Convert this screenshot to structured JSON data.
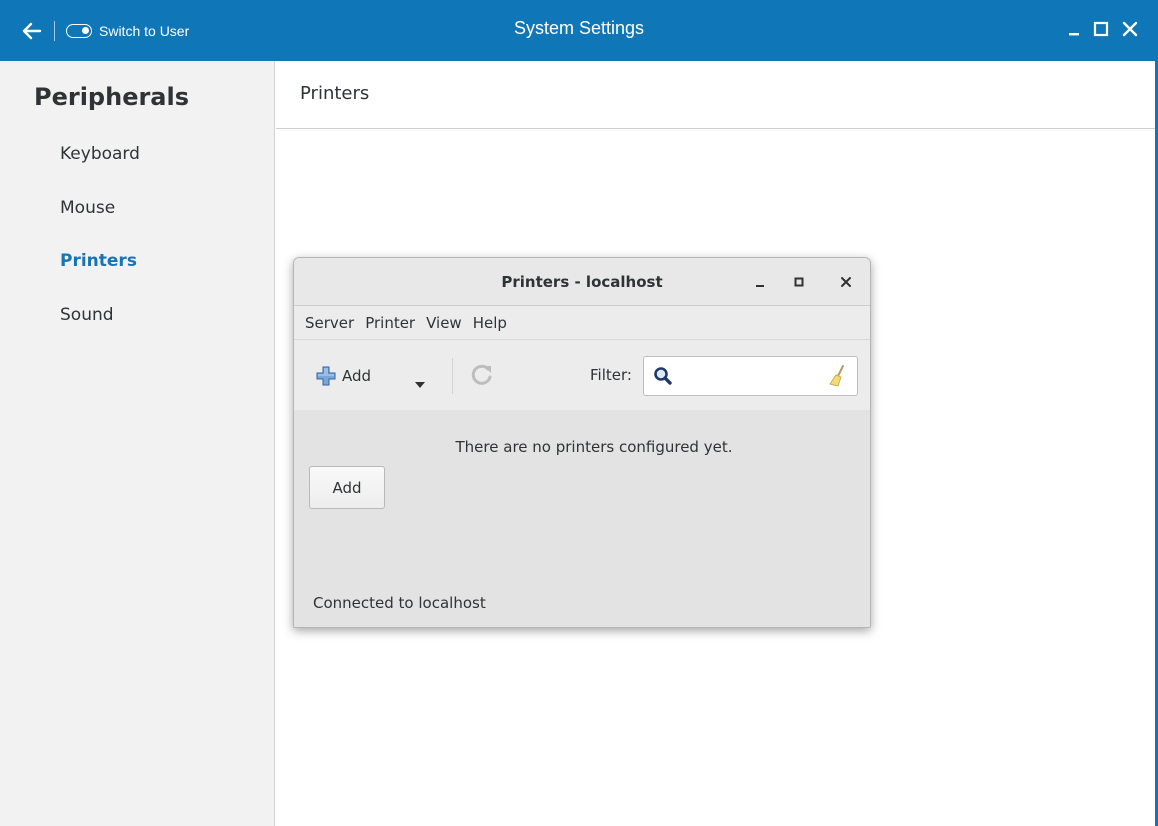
{
  "window": {
    "title": "System Settings",
    "switch_label": "Switch to User",
    "accent": "#0f77b7"
  },
  "sidebar": {
    "heading": "Peripherals",
    "items": [
      {
        "label": "Keyboard",
        "active": false
      },
      {
        "label": "Mouse",
        "active": false
      },
      {
        "label": "Printers",
        "active": true
      },
      {
        "label": "Sound",
        "active": false
      }
    ]
  },
  "main": {
    "title": "Printers"
  },
  "dialog": {
    "title": "Printers - localhost",
    "menu": [
      "Server",
      "Printer",
      "View",
      "Help"
    ],
    "toolbar": {
      "add_label": "Add",
      "filter_label": "Filter:",
      "filter_value": ""
    },
    "empty_message": "There are no printers configured yet.",
    "add_button": "Add",
    "status": "Connected to localhost"
  },
  "icons": [
    "back-arrow-icon",
    "toggle-icon",
    "minimize-icon",
    "maximize-icon",
    "close-icon",
    "plus-icon",
    "chevron-down-icon",
    "refresh-icon",
    "search-icon",
    "clear-broom-icon"
  ]
}
